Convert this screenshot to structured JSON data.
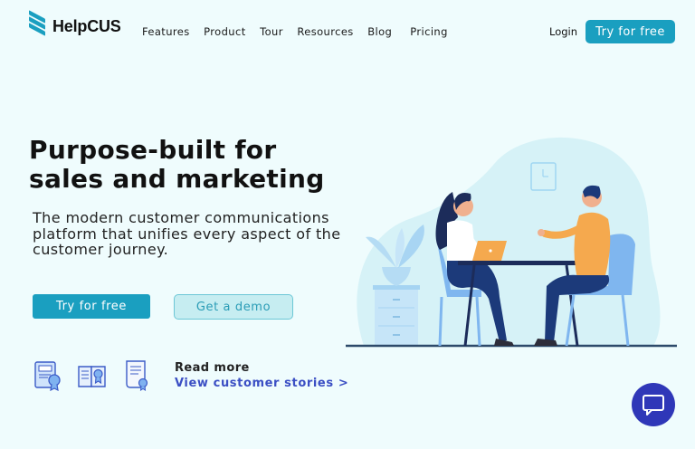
{
  "brand": {
    "name": "HelpCUS",
    "accent": "#1a9fc0"
  },
  "nav": {
    "items": [
      "Features",
      "Product",
      "Tour",
      "Resources",
      "Blog",
      "Pricing"
    ],
    "login": "Login",
    "cta": "Try for free"
  },
  "hero": {
    "headline": "Purpose-built for sales and marketing",
    "subheadline": "The modern customer communications platform that unifies every aspect of the customer journey.",
    "primary_cta": "Try for free",
    "secondary_cta": "Get a demo"
  },
  "badges": [
    {
      "icon": "seo-certificate-icon"
    },
    {
      "icon": "award-book-icon"
    },
    {
      "icon": "certificate-scroll-icon"
    }
  ],
  "read_more": {
    "label": "Read more",
    "link": "View customer stories >"
  },
  "chat_widget": {
    "icon": "chat-icon",
    "color": "#2f37b8"
  }
}
